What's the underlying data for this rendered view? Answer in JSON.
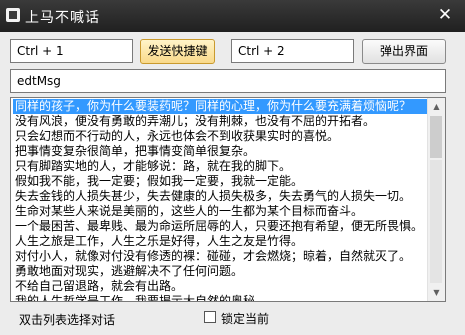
{
  "window": {
    "title": "上马不喊话",
    "close_glyph": "✕"
  },
  "row1": {
    "hotkey1_value": "Ctrl + 1",
    "send_label": "发送快捷键",
    "hotkey2_value": "Ctrl + 2",
    "popup_label": "弹出界面"
  },
  "message_field": {
    "value": "edtMsg"
  },
  "list": {
    "selected_index": 0,
    "items": [
      "同样的孩子，你为什么要装药呢？同样的心理，你为什么要充满着烦恼呢？",
      "没有风浪，便没有勇敢的弄潮儿；没有荆棘，也没有不屈的开拓者。",
      "只会幻想而不行动的人，永远也体会不到收获果实时的喜悦。",
      "把事情变复杂很简单，把事情变简单很复杂。",
      "只有脚踏实地的人，才能够说：路，就在我的脚下。",
      "假如我不能，我一定要；假如我一定要，我就一定能。",
      "失去金钱的人损失甚少，失去健康的人损失极多，失去勇气的人损失一切。",
      "生命对某些人来说是美丽的，这些人的一生都为某个目标而奋斗。",
      "一个最困苦、最卑贱、最为命运所屈辱的人，只要还抱有希望，便无所畏惧。",
      "人生之旅是工作，人生之乐是好得，人生之友是竹得。",
      "对付小人，就像对付没有修透的裸：碰碰，才会燃烧；晾着，自然就灭了。",
      "勇敢地面对现实，逃避解决不了任何问题。",
      "不给自己留退路，就会有出路。",
      "我的人生哲学是工作，我要揭示大自然的奥秘，",
      "机会只对进取有为的人开放，庸人永远无法光顾。"
    ]
  },
  "footer": {
    "hint": "双击列表选择对话",
    "lock_label": "锁定当前",
    "lock_checked": false
  }
}
